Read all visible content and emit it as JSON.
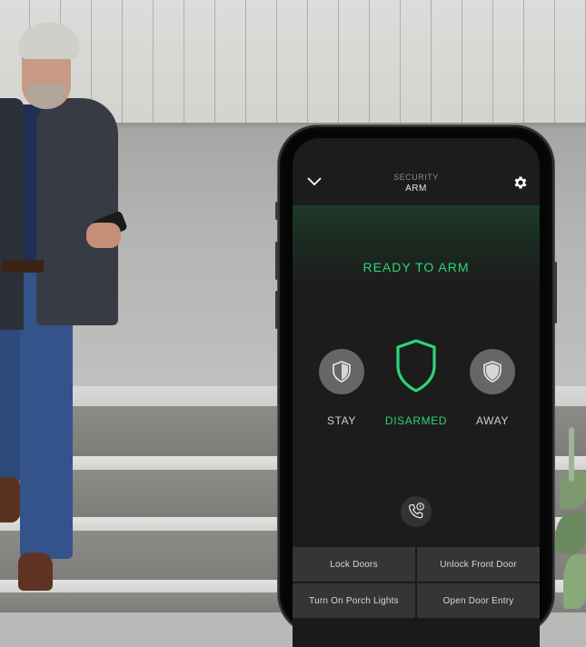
{
  "app": {
    "header": {
      "back_icon": "chevron-down-icon",
      "subtitle": "SECURITY",
      "title": "ARM",
      "settings_icon": "gear-icon"
    },
    "status": {
      "text": "READY TO ARM",
      "color": "#2ed47a"
    },
    "modes": [
      {
        "id": "stay",
        "label": "STAY",
        "icon": "shield-half-icon",
        "active": false
      },
      {
        "id": "disarmed",
        "label": "DISARMED",
        "icon": "shield-outline-icon",
        "active": true
      },
      {
        "id": "away",
        "label": "AWAY",
        "icon": "shield-filled-icon",
        "active": false
      }
    ],
    "alert_button_icon": "phone-alert-icon",
    "actions": [
      {
        "label": "Lock Doors"
      },
      {
        "label": "Unlock Front Door"
      },
      {
        "label": "Turn On Porch Lights"
      },
      {
        "label": "Open Door Entry"
      }
    ],
    "colors": {
      "accent": "#2ed47a",
      "screen_bg": "#1c1c1c",
      "button_bg": "#353535",
      "mode_circle": "#666666"
    }
  }
}
